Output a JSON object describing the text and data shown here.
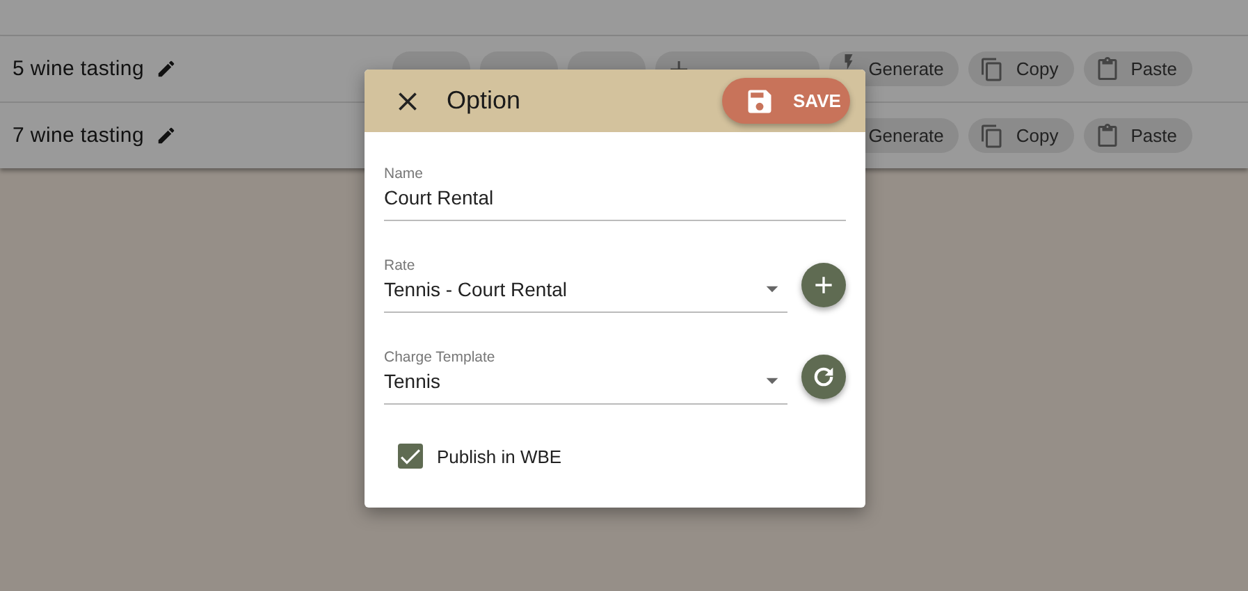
{
  "rows": [
    {
      "title": "5 wine tasting",
      "chips": [
        {
          "kind": "time"
        },
        {
          "kind": "time"
        },
        {
          "kind": "time"
        },
        {
          "kind": "add"
        },
        {
          "label": "Generate",
          "kind": "generate"
        },
        {
          "label": "Copy",
          "kind": "copy"
        },
        {
          "label": "Paste",
          "kind": "paste"
        }
      ]
    },
    {
      "title": "7 wine tasting",
      "chips": [
        {
          "label": "Generate",
          "kind": "plain"
        },
        {
          "label": "Copy",
          "kind": "copy"
        },
        {
          "label": "Paste",
          "kind": "paste"
        }
      ]
    }
  ],
  "dialog": {
    "title": "Option",
    "save_button": "SAVE",
    "fields": [
      {
        "label": "Name",
        "value": "Court Rental",
        "kind": "text"
      },
      {
        "label": "Rate",
        "value": "Tennis - Court Rental",
        "kind": "select",
        "button": {
          "kind": "add"
        }
      },
      {
        "label": "Charge Template",
        "value": "Tennis",
        "kind": "select",
        "button": {
          "kind": "refresh"
        }
      }
    ],
    "publish": {
      "label": "Publish in WBE",
      "checked": true
    }
  }
}
